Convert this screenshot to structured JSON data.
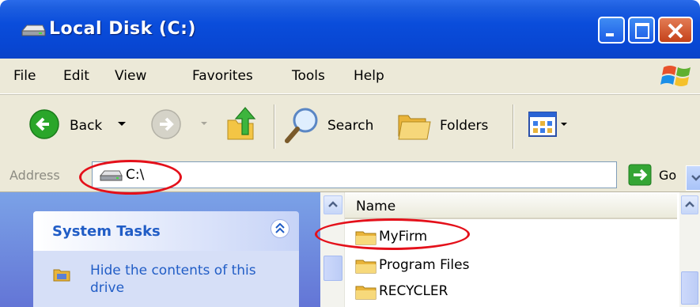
{
  "window": {
    "title": "Local Disk (C:)",
    "icon": "drive-icon"
  },
  "menu": {
    "items": [
      "File",
      "Edit",
      "View",
      "Favorites",
      "Tools",
      "Help"
    ]
  },
  "toolbar": {
    "back_label": "Back",
    "search_label": "Search",
    "folders_label": "Folders"
  },
  "address": {
    "label": "Address",
    "value": "C:\\",
    "go_label": "Go"
  },
  "tasks": {
    "header": "System Tasks",
    "link_label": "Hide the contents of this drive"
  },
  "files": {
    "column_name": "Name",
    "items": [
      "MyFirm",
      "Program Files",
      "RECYCLER"
    ]
  },
  "colors": {
    "title_bar": "#0a4ddb",
    "annotation": "#e4101a",
    "task_link": "#215dc6"
  }
}
